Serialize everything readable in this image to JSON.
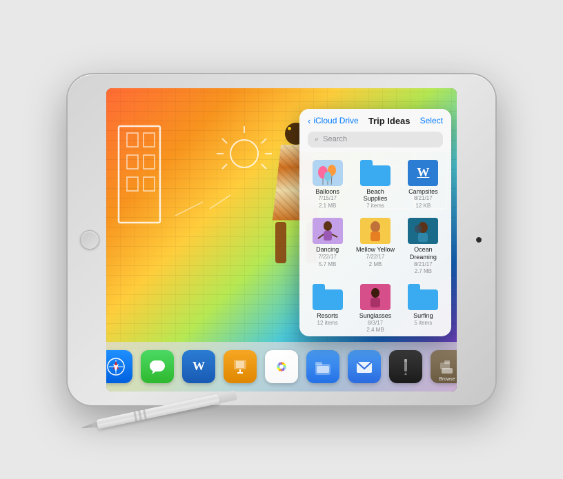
{
  "scene": {
    "bg_color": "#e0e0e0"
  },
  "files_panel": {
    "nav_back": "iCloud Drive",
    "title": "Trip Ideas",
    "select": "Select",
    "search_placeholder": "Search",
    "files": [
      {
        "name": "Balloons",
        "meta": "7/15/17\n2.1 MB",
        "type": "photo",
        "thumb": "balloons"
      },
      {
        "name": "Beach Supplies",
        "meta": "7 items",
        "type": "folder"
      },
      {
        "name": "Campsites",
        "meta": "8/21/17\n12 KB",
        "type": "word"
      },
      {
        "name": "Dancing",
        "meta": "7/22/17\n5.7 MB",
        "type": "photo",
        "thumb": "dancing"
      },
      {
        "name": "Mellow Yellow",
        "meta": "7/22/17\n2 MB",
        "type": "photo",
        "thumb": "mellow"
      },
      {
        "name": "Ocean Dreaming",
        "meta": "8/21/17\n2.7 MB",
        "type": "photo",
        "thumb": "ocean"
      },
      {
        "name": "Resorts",
        "meta": "12 items",
        "type": "folder"
      },
      {
        "name": "Sunglasses",
        "meta": "8/3/17\n2.4 MB",
        "type": "photo",
        "thumb": "sunglasses"
      },
      {
        "name": "Surfing",
        "meta": "5 items",
        "type": "folder"
      }
    ]
  },
  "dock": {
    "apps": [
      {
        "name": "Safari",
        "icon": "safari"
      },
      {
        "name": "Messages",
        "icon": "messages"
      },
      {
        "name": "Word",
        "icon": "word"
      },
      {
        "name": "Keynote",
        "icon": "keynote"
      },
      {
        "name": "Photos",
        "icon": "photos"
      },
      {
        "name": "Files",
        "icon": "files"
      },
      {
        "name": "Mail",
        "icon": "mail"
      },
      {
        "name": "Pencil",
        "icon": "pencil"
      },
      {
        "name": "Browse",
        "icon": "browse",
        "label": "Browse"
      }
    ]
  }
}
